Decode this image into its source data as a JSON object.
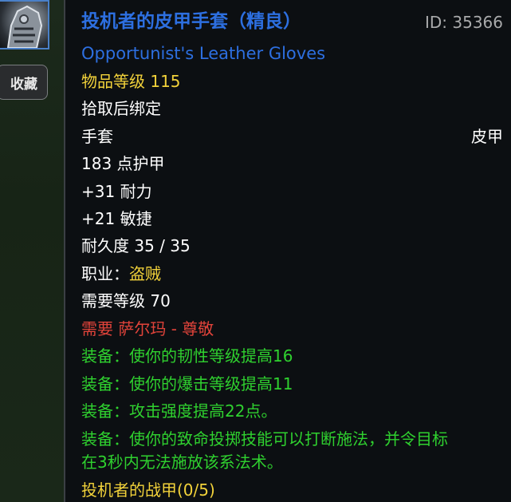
{
  "sidebar": {
    "icon": "gloves-icon",
    "favorite_label": "收藏"
  },
  "tooltip": {
    "title": "投机者的皮甲手套（精良）",
    "id_text": "ID: 35366",
    "english_name": "Opportunist's Leather Gloves",
    "item_level": "物品等级 115",
    "bind": "拾取后绑定",
    "slot": "手套",
    "armor_type": "皮甲",
    "armor": "183 点护甲",
    "stamina": "+31 耐力",
    "agility": "+21 敏捷",
    "durability": "耐久度 35 / 35",
    "class_label": "职业：",
    "class_value": "盗贼",
    "req_level": "需要等级 70",
    "req_rep": "需要 萨尔玛 - 尊敬",
    "equip1": "装备：使你的韧性等级提高16",
    "equip2": "装备：使你的爆击等级提高11",
    "equip3": "装备：攻击强度提高22点。",
    "equip4_line1": "装备：使你的致命投掷技能可以打断施法，并令目标",
    "equip4_line2": "在3秒内无法施放该系法术。",
    "set_name": "投机者的战甲(0/5)"
  },
  "colors": {
    "title_blue": "#2d6fe0",
    "gold": "#f2d23a",
    "red": "#e0433a",
    "green": "#2fd12f"
  }
}
